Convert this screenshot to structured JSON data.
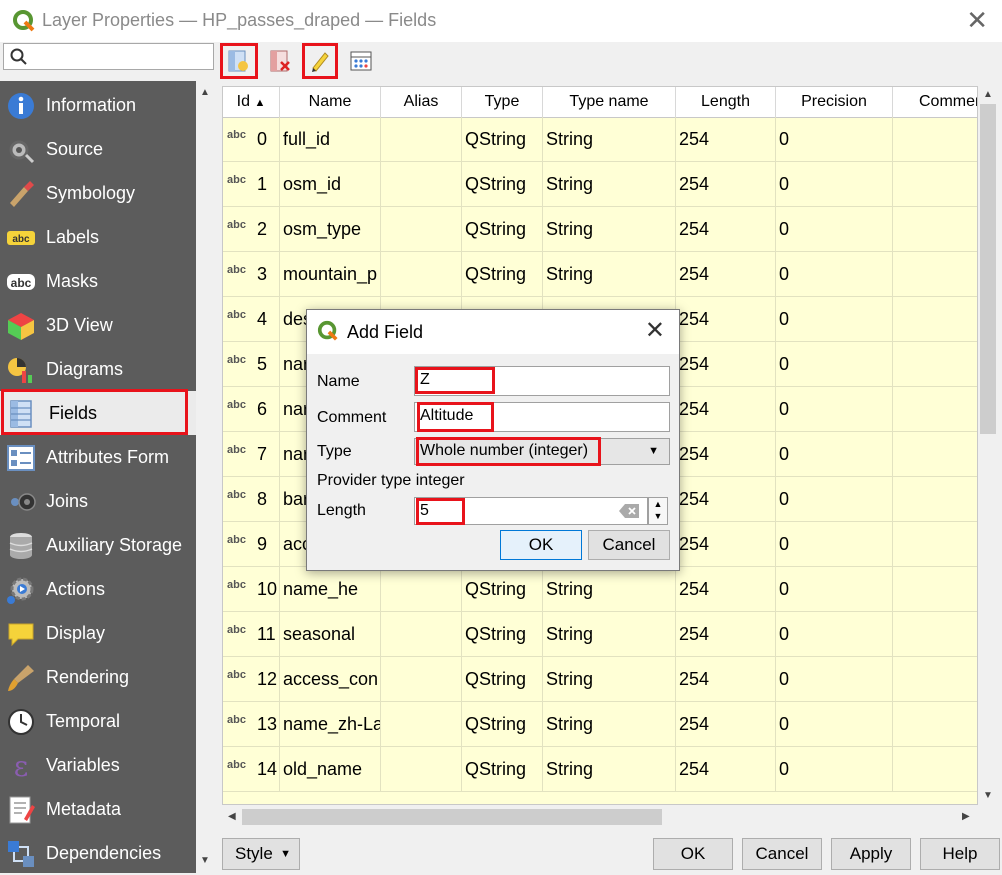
{
  "window": {
    "title": "Layer Properties — HP_passes_draped — Fields",
    "close": "✕"
  },
  "search": {
    "placeholder": ""
  },
  "sidebar": {
    "items": [
      {
        "label": "Information",
        "icon": "information-icon"
      },
      {
        "label": "Source",
        "icon": "source-icon"
      },
      {
        "label": "Symbology",
        "icon": "symbology-icon"
      },
      {
        "label": "Labels",
        "icon": "labels-icon"
      },
      {
        "label": "Masks",
        "icon": "masks-icon"
      },
      {
        "label": "3D View",
        "icon": "3d-view-icon"
      },
      {
        "label": "Diagrams",
        "icon": "diagrams-icon"
      },
      {
        "label": "Fields",
        "icon": "fields-icon"
      },
      {
        "label": "Attributes Form",
        "icon": "attributes-form-icon"
      },
      {
        "label": "Joins",
        "icon": "joins-icon"
      },
      {
        "label": "Auxiliary Storage",
        "icon": "auxiliary-storage-icon"
      },
      {
        "label": "Actions",
        "icon": "actions-icon"
      },
      {
        "label": "Display",
        "icon": "display-icon"
      },
      {
        "label": "Rendering",
        "icon": "rendering-icon"
      },
      {
        "label": "Temporal",
        "icon": "temporal-icon"
      },
      {
        "label": "Variables",
        "icon": "variables-icon"
      },
      {
        "label": "Metadata",
        "icon": "metadata-icon"
      },
      {
        "label": "Dependencies",
        "icon": "dependencies-icon"
      }
    ],
    "active": "Fields"
  },
  "table": {
    "headers": [
      "Id",
      "Name",
      "Alias",
      "Type",
      "Type name",
      "Length",
      "Precision",
      "Commen"
    ],
    "type_badge": "abc",
    "rows": [
      {
        "id": "0",
        "name": "full_id",
        "alias": "",
        "type": "QString",
        "type_name": "String",
        "length": "254",
        "precision": "0"
      },
      {
        "id": "1",
        "name": "osm_id",
        "alias": "",
        "type": "QString",
        "type_name": "String",
        "length": "254",
        "precision": "0"
      },
      {
        "id": "2",
        "name": "osm_type",
        "alias": "",
        "type": "QString",
        "type_name": "String",
        "length": "254",
        "precision": "0"
      },
      {
        "id": "3",
        "name": "mountain_p",
        "alias": "",
        "type": "QString",
        "type_name": "String",
        "length": "254",
        "precision": "0"
      },
      {
        "id": "4",
        "name": "des",
        "alias": "",
        "type": "",
        "type_name": "",
        "length": "254",
        "precision": "0"
      },
      {
        "id": "5",
        "name": "nar",
        "alias": "",
        "type": "",
        "type_name": "",
        "length": "254",
        "precision": "0"
      },
      {
        "id": "6",
        "name": "nar",
        "alias": "",
        "type": "",
        "type_name": "",
        "length": "254",
        "precision": "0"
      },
      {
        "id": "7",
        "name": "nar",
        "alias": "",
        "type": "",
        "type_name": "",
        "length": "254",
        "precision": "0"
      },
      {
        "id": "8",
        "name": "bar",
        "alias": "",
        "type": "",
        "type_name": "",
        "length": "254",
        "precision": "0"
      },
      {
        "id": "9",
        "name": "acc",
        "alias": "",
        "type": "",
        "type_name": "",
        "length": "254",
        "precision": "0"
      },
      {
        "id": "10",
        "name": "name_he",
        "alias": "",
        "type": "QString",
        "type_name": "String",
        "length": "254",
        "precision": "0"
      },
      {
        "id": "11",
        "name": "seasonal",
        "alias": "",
        "type": "QString",
        "type_name": "String",
        "length": "254",
        "precision": "0"
      },
      {
        "id": "12",
        "name": "access_con",
        "alias": "",
        "type": "QString",
        "type_name": "String",
        "length": "254",
        "precision": "0"
      },
      {
        "id": "13",
        "name": "name_zh-La",
        "alias": "",
        "type": "QString",
        "type_name": "String",
        "length": "254",
        "precision": "0"
      },
      {
        "id": "14",
        "name": "old_name",
        "alias": "",
        "type": "QString",
        "type_name": "String",
        "length": "254",
        "precision": "0"
      }
    ]
  },
  "bottom": {
    "style": "Style",
    "ok": "OK",
    "cancel": "Cancel",
    "apply": "Apply",
    "help": "Help"
  },
  "dialog": {
    "title": "Add Field",
    "name_label": "Name",
    "name_value": "Z",
    "comment_label": "Comment",
    "comment_value": "Altitude",
    "type_label": "Type",
    "type_value": "Whole number (integer)",
    "provider_text": "Provider type integer",
    "length_label": "Length",
    "length_value": "5",
    "ok": "OK",
    "cancel": "Cancel"
  },
  "colors": {
    "highlight": "#e8131b",
    "sidebar_bg": "#5c5c5c",
    "table_bg": "#ffffd6",
    "qgis_green": "#589632"
  }
}
